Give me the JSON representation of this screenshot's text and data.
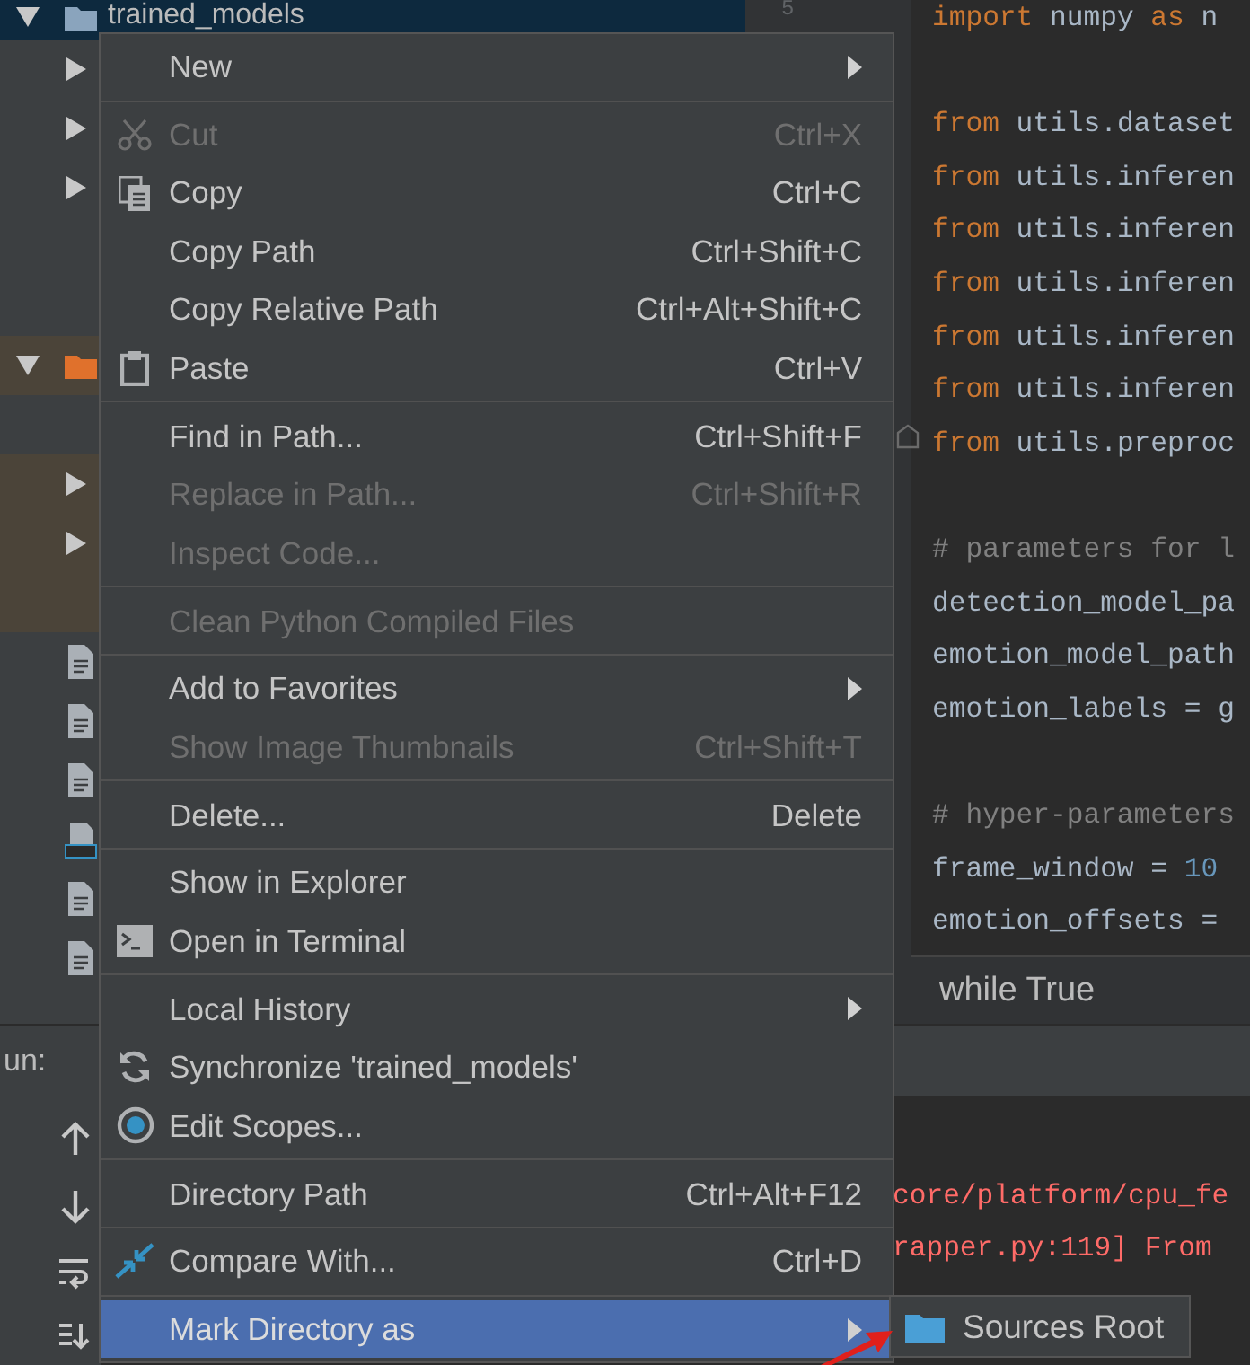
{
  "project_tree": [
    {
      "kind": "folder",
      "label": "trained_models",
      "expanded": true,
      "selected": true,
      "children": [
        {
          "kind": "folder",
          "expanded": false
        },
        {
          "kind": "folder",
          "expanded": false
        },
        {
          "kind": "folder",
          "expanded": false
        }
      ]
    },
    {
      "kind": "orange_folder",
      "expanded": true,
      "selected": false,
      "children": [
        {
          "kind": "folder",
          "expanded": false
        },
        {
          "kind": "folder",
          "expanded": false
        },
        {
          "kind": "file"
        },
        {
          "kind": "file"
        },
        {
          "kind": "file"
        },
        {
          "kind": "markdown"
        },
        {
          "kind": "file"
        },
        {
          "kind": "file"
        }
      ]
    }
  ],
  "gutter": {
    "line_number": "5"
  },
  "editor": {
    "lines": [
      {
        "blank_before": false,
        "segments": [
          {
            "kind": "keyword",
            "text": "import"
          },
          {
            "kind": "plain",
            "text": " numpy "
          },
          {
            "kind": "keyword",
            "text": "as"
          },
          {
            "kind": "plain",
            "text": " n"
          }
        ]
      },
      {
        "blank_before": true,
        "segments": [
          {
            "kind": "keyword",
            "text": "from"
          },
          {
            "kind": "plain",
            "text": " utils.dataset"
          }
        ]
      },
      {
        "blank_before": false,
        "segments": [
          {
            "kind": "keyword",
            "text": "from"
          },
          {
            "kind": "plain",
            "text": " utils.inferen"
          }
        ]
      },
      {
        "blank_before": false,
        "segments": [
          {
            "kind": "keyword",
            "text": "from"
          },
          {
            "kind": "plain",
            "text": " utils.inferen"
          }
        ]
      },
      {
        "blank_before": false,
        "segments": [
          {
            "kind": "keyword",
            "text": "from"
          },
          {
            "kind": "plain",
            "text": " utils.inferen"
          }
        ]
      },
      {
        "blank_before": false,
        "segments": [
          {
            "kind": "keyword",
            "text": "from"
          },
          {
            "kind": "plain",
            "text": " utils.inferen"
          }
        ]
      },
      {
        "blank_before": false,
        "segments": [
          {
            "kind": "keyword",
            "text": "from"
          },
          {
            "kind": "plain",
            "text": " utils.inferen"
          }
        ]
      },
      {
        "blank_before": false,
        "segments": [
          {
            "kind": "keyword",
            "text": "from"
          },
          {
            "kind": "plain",
            "text": " utils.preproc"
          }
        ]
      },
      {
        "blank_before": true,
        "segments": [
          {
            "kind": "comment",
            "text": "# parameters for l"
          }
        ]
      },
      {
        "blank_before": false,
        "segments": [
          {
            "kind": "plain",
            "text": "detection_model_pa"
          }
        ]
      },
      {
        "blank_before": false,
        "segments": [
          {
            "kind": "plain",
            "text": "emotion_model_path"
          }
        ]
      },
      {
        "blank_before": false,
        "segments": [
          {
            "kind": "plain",
            "text": "emotion_labels = g"
          }
        ]
      },
      {
        "blank_before": true,
        "segments": [
          {
            "kind": "comment",
            "text": "# hyper-parameters"
          }
        ]
      },
      {
        "blank_before": false,
        "segments": [
          {
            "kind": "plain",
            "text": "frame_window = "
          },
          {
            "kind": "number",
            "text": "10"
          }
        ]
      },
      {
        "blank_before": false,
        "segments": [
          {
            "kind": "plain",
            "text": "emotion_offsets ="
          }
        ]
      }
    ],
    "breadcrumb": "while True"
  },
  "run_panel": {
    "tab_label": "un:",
    "console_lines": [
      "core/platform/cpu_fe",
      "rapper.py:119] From"
    ]
  },
  "context_menu": {
    "items": [
      {
        "kind": "item",
        "label": "New",
        "disabled": false,
        "submenu": true,
        "selected": false
      },
      {
        "kind": "separator"
      },
      {
        "kind": "item",
        "label": "Cut",
        "shortcut": "Ctrl+X",
        "disabled": true,
        "submenu": false,
        "selected": false
      },
      {
        "kind": "item",
        "label": "Copy",
        "shortcut": "Ctrl+C",
        "disabled": false,
        "submenu": false,
        "selected": false
      },
      {
        "kind": "item",
        "label": "Copy Path",
        "shortcut": "Ctrl+Shift+C",
        "disabled": false,
        "submenu": false,
        "selected": false
      },
      {
        "kind": "item",
        "label": "Copy Relative Path",
        "shortcut": "Ctrl+Alt+Shift+C",
        "disabled": false,
        "submenu": false,
        "selected": false
      },
      {
        "kind": "item",
        "label": "Paste",
        "shortcut": "Ctrl+V",
        "disabled": false,
        "submenu": false,
        "selected": false
      },
      {
        "kind": "separator"
      },
      {
        "kind": "item",
        "label": "Find in Path...",
        "shortcut": "Ctrl+Shift+F",
        "disabled": false,
        "submenu": false,
        "selected": false
      },
      {
        "kind": "item",
        "label": "Replace in Path...",
        "shortcut": "Ctrl+Shift+R",
        "disabled": true,
        "submenu": false,
        "selected": false
      },
      {
        "kind": "item",
        "label": "Inspect Code...",
        "disabled": true,
        "submenu": false,
        "selected": false
      },
      {
        "kind": "separator"
      },
      {
        "kind": "item",
        "label": "Clean Python Compiled Files",
        "disabled": true,
        "submenu": false,
        "selected": false
      },
      {
        "kind": "separator"
      },
      {
        "kind": "item",
        "label": "Add to Favorites",
        "disabled": false,
        "submenu": true,
        "selected": false
      },
      {
        "kind": "item",
        "label": "Show Image Thumbnails",
        "shortcut": "Ctrl+Shift+T",
        "disabled": true,
        "submenu": false,
        "selected": false
      },
      {
        "kind": "separator"
      },
      {
        "kind": "item",
        "label": "Delete...",
        "shortcut": "Delete",
        "disabled": false,
        "submenu": false,
        "selected": false
      },
      {
        "kind": "separator"
      },
      {
        "kind": "item",
        "label": "Show in Explorer",
        "disabled": false,
        "submenu": false,
        "selected": false
      },
      {
        "kind": "item",
        "label": "Open in Terminal",
        "disabled": false,
        "submenu": false,
        "selected": false
      },
      {
        "kind": "separator"
      },
      {
        "kind": "item",
        "label": "Local History",
        "disabled": false,
        "submenu": true,
        "selected": false
      },
      {
        "kind": "item",
        "label": "Synchronize 'trained_models'",
        "disabled": false,
        "submenu": false,
        "selected": false
      },
      {
        "kind": "item",
        "label": "Edit Scopes...",
        "disabled": false,
        "submenu": false,
        "selected": false
      },
      {
        "kind": "separator"
      },
      {
        "kind": "item",
        "label": "Directory Path",
        "shortcut": "Ctrl+Alt+F12",
        "disabled": false,
        "submenu": false,
        "selected": false
      },
      {
        "kind": "separator"
      },
      {
        "kind": "item",
        "label": "Compare With...",
        "shortcut": "Ctrl+D",
        "disabled": false,
        "submenu": false,
        "selected": false
      },
      {
        "kind": "separator"
      },
      {
        "kind": "item",
        "label": "Mark Directory as",
        "disabled": false,
        "submenu": true,
        "selected": true
      }
    ]
  },
  "submenu": {
    "items": [
      {
        "label": "Sources Root",
        "selected": false
      }
    ]
  }
}
